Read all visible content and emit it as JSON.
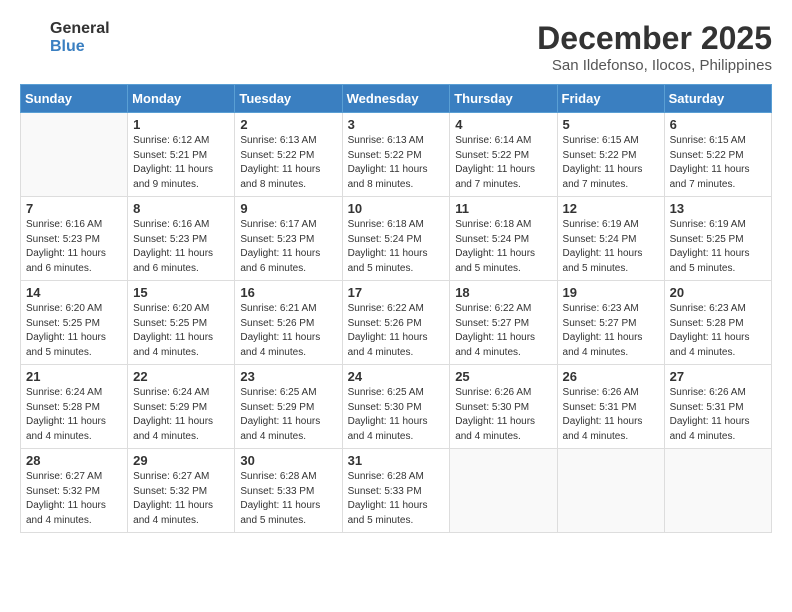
{
  "logo": {
    "line1": "General",
    "line2": "Blue"
  },
  "title": "December 2025",
  "location": "San Ildefonso, Ilocos, Philippines",
  "weekdays": [
    "Sunday",
    "Monday",
    "Tuesday",
    "Wednesday",
    "Thursday",
    "Friday",
    "Saturday"
  ],
  "weeks": [
    [
      {
        "day": "",
        "sunrise": "",
        "sunset": "",
        "daylight": ""
      },
      {
        "day": "1",
        "sunrise": "Sunrise: 6:12 AM",
        "sunset": "Sunset: 5:21 PM",
        "daylight": "Daylight: 11 hours and 9 minutes."
      },
      {
        "day": "2",
        "sunrise": "Sunrise: 6:13 AM",
        "sunset": "Sunset: 5:22 PM",
        "daylight": "Daylight: 11 hours and 8 minutes."
      },
      {
        "day": "3",
        "sunrise": "Sunrise: 6:13 AM",
        "sunset": "Sunset: 5:22 PM",
        "daylight": "Daylight: 11 hours and 8 minutes."
      },
      {
        "day": "4",
        "sunrise": "Sunrise: 6:14 AM",
        "sunset": "Sunset: 5:22 PM",
        "daylight": "Daylight: 11 hours and 7 minutes."
      },
      {
        "day": "5",
        "sunrise": "Sunrise: 6:15 AM",
        "sunset": "Sunset: 5:22 PM",
        "daylight": "Daylight: 11 hours and 7 minutes."
      },
      {
        "day": "6",
        "sunrise": "Sunrise: 6:15 AM",
        "sunset": "Sunset: 5:22 PM",
        "daylight": "Daylight: 11 hours and 7 minutes."
      }
    ],
    [
      {
        "day": "7",
        "sunrise": "Sunrise: 6:16 AM",
        "sunset": "Sunset: 5:23 PM",
        "daylight": "Daylight: 11 hours and 6 minutes."
      },
      {
        "day": "8",
        "sunrise": "Sunrise: 6:16 AM",
        "sunset": "Sunset: 5:23 PM",
        "daylight": "Daylight: 11 hours and 6 minutes."
      },
      {
        "day": "9",
        "sunrise": "Sunrise: 6:17 AM",
        "sunset": "Sunset: 5:23 PM",
        "daylight": "Daylight: 11 hours and 6 minutes."
      },
      {
        "day": "10",
        "sunrise": "Sunrise: 6:18 AM",
        "sunset": "Sunset: 5:24 PM",
        "daylight": "Daylight: 11 hours and 5 minutes."
      },
      {
        "day": "11",
        "sunrise": "Sunrise: 6:18 AM",
        "sunset": "Sunset: 5:24 PM",
        "daylight": "Daylight: 11 hours and 5 minutes."
      },
      {
        "day": "12",
        "sunrise": "Sunrise: 6:19 AM",
        "sunset": "Sunset: 5:24 PM",
        "daylight": "Daylight: 11 hours and 5 minutes."
      },
      {
        "day": "13",
        "sunrise": "Sunrise: 6:19 AM",
        "sunset": "Sunset: 5:25 PM",
        "daylight": "Daylight: 11 hours and 5 minutes."
      }
    ],
    [
      {
        "day": "14",
        "sunrise": "Sunrise: 6:20 AM",
        "sunset": "Sunset: 5:25 PM",
        "daylight": "Daylight: 11 hours and 5 minutes."
      },
      {
        "day": "15",
        "sunrise": "Sunrise: 6:20 AM",
        "sunset": "Sunset: 5:25 PM",
        "daylight": "Daylight: 11 hours and 4 minutes."
      },
      {
        "day": "16",
        "sunrise": "Sunrise: 6:21 AM",
        "sunset": "Sunset: 5:26 PM",
        "daylight": "Daylight: 11 hours and 4 minutes."
      },
      {
        "day": "17",
        "sunrise": "Sunrise: 6:22 AM",
        "sunset": "Sunset: 5:26 PM",
        "daylight": "Daylight: 11 hours and 4 minutes."
      },
      {
        "day": "18",
        "sunrise": "Sunrise: 6:22 AM",
        "sunset": "Sunset: 5:27 PM",
        "daylight": "Daylight: 11 hours and 4 minutes."
      },
      {
        "day": "19",
        "sunrise": "Sunrise: 6:23 AM",
        "sunset": "Sunset: 5:27 PM",
        "daylight": "Daylight: 11 hours and 4 minutes."
      },
      {
        "day": "20",
        "sunrise": "Sunrise: 6:23 AM",
        "sunset": "Sunset: 5:28 PM",
        "daylight": "Daylight: 11 hours and 4 minutes."
      }
    ],
    [
      {
        "day": "21",
        "sunrise": "Sunrise: 6:24 AM",
        "sunset": "Sunset: 5:28 PM",
        "daylight": "Daylight: 11 hours and 4 minutes."
      },
      {
        "day": "22",
        "sunrise": "Sunrise: 6:24 AM",
        "sunset": "Sunset: 5:29 PM",
        "daylight": "Daylight: 11 hours and 4 minutes."
      },
      {
        "day": "23",
        "sunrise": "Sunrise: 6:25 AM",
        "sunset": "Sunset: 5:29 PM",
        "daylight": "Daylight: 11 hours and 4 minutes."
      },
      {
        "day": "24",
        "sunrise": "Sunrise: 6:25 AM",
        "sunset": "Sunset: 5:30 PM",
        "daylight": "Daylight: 11 hours and 4 minutes."
      },
      {
        "day": "25",
        "sunrise": "Sunrise: 6:26 AM",
        "sunset": "Sunset: 5:30 PM",
        "daylight": "Daylight: 11 hours and 4 minutes."
      },
      {
        "day": "26",
        "sunrise": "Sunrise: 6:26 AM",
        "sunset": "Sunset: 5:31 PM",
        "daylight": "Daylight: 11 hours and 4 minutes."
      },
      {
        "day": "27",
        "sunrise": "Sunrise: 6:26 AM",
        "sunset": "Sunset: 5:31 PM",
        "daylight": "Daylight: 11 hours and 4 minutes."
      }
    ],
    [
      {
        "day": "28",
        "sunrise": "Sunrise: 6:27 AM",
        "sunset": "Sunset: 5:32 PM",
        "daylight": "Daylight: 11 hours and 4 minutes."
      },
      {
        "day": "29",
        "sunrise": "Sunrise: 6:27 AM",
        "sunset": "Sunset: 5:32 PM",
        "daylight": "Daylight: 11 hours and 4 minutes."
      },
      {
        "day": "30",
        "sunrise": "Sunrise: 6:28 AM",
        "sunset": "Sunset: 5:33 PM",
        "daylight": "Daylight: 11 hours and 5 minutes."
      },
      {
        "day": "31",
        "sunrise": "Sunrise: 6:28 AM",
        "sunset": "Sunset: 5:33 PM",
        "daylight": "Daylight: 11 hours and 5 minutes."
      },
      {
        "day": "",
        "sunrise": "",
        "sunset": "",
        "daylight": ""
      },
      {
        "day": "",
        "sunrise": "",
        "sunset": "",
        "daylight": ""
      },
      {
        "day": "",
        "sunrise": "",
        "sunset": "",
        "daylight": ""
      }
    ]
  ]
}
